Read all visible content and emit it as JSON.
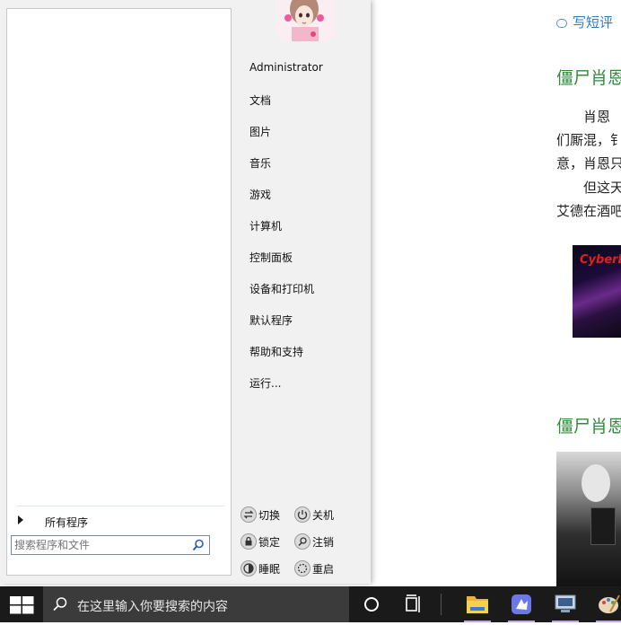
{
  "background_page": {
    "review_link": "写短评",
    "article_title_1": "僵尸肖恩",
    "paragraph_lines": [
      "　　肖恩",
      "们厮混，钅",
      "意，肖恩只",
      "　　但这天",
      "艾德在酒吧"
    ],
    "ad_logo": "CyberLi",
    "article_title_2": "僵尸肖恩"
  },
  "start_menu": {
    "all_programs": "所有程序",
    "search_placeholder": "搜索程序和文件",
    "right_items": [
      "Administrator",
      "文档",
      "图片",
      "音乐",
      "游戏",
      "计算机",
      "控制面板",
      "设备和打印机",
      "默认程序",
      "帮助和支持",
      "运行..."
    ],
    "power_buttons": {
      "switch": "切换",
      "shutdown": "关机",
      "lock": "锁定",
      "logoff": "注销",
      "sleep": "睡眠",
      "restart": "重启"
    }
  },
  "taskbar": {
    "search_placeholder": "在这里输入你要搜索的内容",
    "icons": [
      "start-icon",
      "search-icon",
      "cortana-icon",
      "task-view-icon",
      "file-explorer-icon",
      "app-icon",
      "network-app-icon",
      "paint-app-icon"
    ]
  },
  "colors": {
    "link_blue": "#2c7bbf",
    "title_green": "#2f8a3c",
    "taskbar_bg": "#1a1a1a",
    "active_indicator": "#c4a5e8"
  }
}
